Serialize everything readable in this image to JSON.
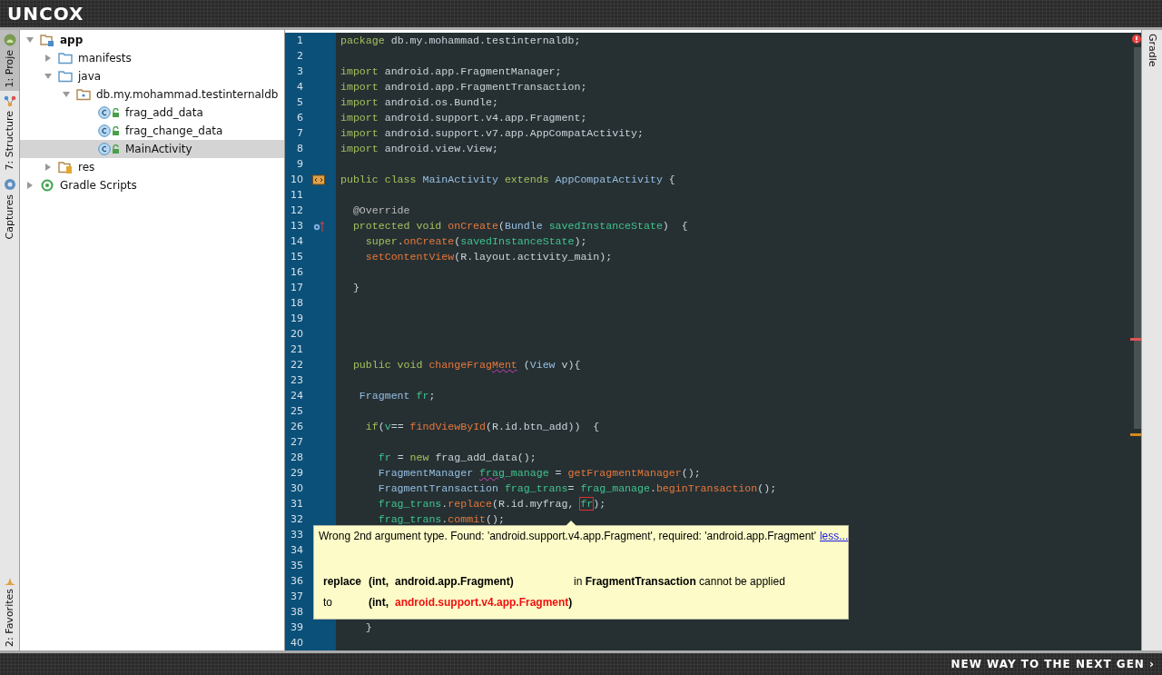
{
  "top_bar": {
    "logo": "UNCOX"
  },
  "left_tool_tabs": [
    {
      "label": "1: Proje",
      "selected": true
    },
    {
      "label": "7: Structure",
      "selected": false
    },
    {
      "label": "Captures",
      "selected": false
    },
    {
      "label": "2: Favorites",
      "selected": false
    }
  ],
  "project_tree": [
    {
      "label": "app",
      "kind": "module",
      "expanded": true,
      "selected": false,
      "children": [
        {
          "label": "manifests",
          "kind": "folder",
          "expanded": false,
          "selected": false
        },
        {
          "label": "java",
          "kind": "folder",
          "expanded": true,
          "selected": false,
          "children": [
            {
              "label": "db.my.mohammad.testinternaldb",
              "kind": "package",
              "expanded": true,
              "selected": false,
              "children": [
                {
                  "label": "frag_add_data",
                  "kind": "class",
                  "selected": false
                },
                {
                  "label": "frag_change_data",
                  "kind": "class",
                  "selected": false
                },
                {
                  "label": "MainActivity",
                  "kind": "class",
                  "selected": true
                }
              ]
            }
          ]
        },
        {
          "label": "res",
          "kind": "resources",
          "expanded": false,
          "selected": false
        }
      ]
    },
    {
      "label": "Gradle Scripts",
      "kind": "gradle",
      "expanded": false,
      "selected": false
    }
  ],
  "editor": {
    "lines": [
      {
        "number": "1",
        "tokens": [
          {
            "text": "package ",
            "kind": "keyword"
          },
          {
            "text": "db.my.mohammad.testinternaldb;",
            "kind": "plain"
          }
        ]
      },
      {
        "number": "2"
      },
      {
        "number": "3",
        "tokens": [
          {
            "text": "import ",
            "kind": "keyword"
          },
          {
            "text": "android.app.FragmentManager;",
            "kind": "plain"
          }
        ]
      },
      {
        "number": "4",
        "tokens": [
          {
            "text": "import ",
            "kind": "keyword"
          },
          {
            "text": "android.app.FragmentTransaction;",
            "kind": "plain"
          }
        ]
      },
      {
        "number": "5",
        "tokens": [
          {
            "text": "import ",
            "kind": "keyword"
          },
          {
            "text": "android.os.Bundle;",
            "kind": "plain"
          }
        ]
      },
      {
        "number": "6",
        "tokens": [
          {
            "text": "import ",
            "kind": "keyword"
          },
          {
            "text": "android.support.v4.app.Fragment;",
            "kind": "plain"
          }
        ]
      },
      {
        "number": "7",
        "tokens": [
          {
            "text": "import ",
            "kind": "keyword"
          },
          {
            "text": "android.support.v7.app.AppCompatActivity;",
            "kind": "plain"
          }
        ]
      },
      {
        "number": "8",
        "tokens": [
          {
            "text": "import ",
            "kind": "keyword"
          },
          {
            "text": "android.view.View;",
            "kind": "plain"
          }
        ]
      },
      {
        "number": "9"
      },
      {
        "number": "10",
        "kind": "implements",
        "tokens": [
          {
            "text": "public class ",
            "kind": "keyword"
          },
          {
            "text": "MainActivity ",
            "kind": "type"
          },
          {
            "text": "extends ",
            "kind": "keyword"
          },
          {
            "text": "AppCompatActivity ",
            "kind": "type"
          },
          {
            "text": "{",
            "kind": "plain"
          }
        ]
      },
      {
        "number": "11"
      },
      {
        "number": "12",
        "tokens": [
          {
            "text": "  @Override",
            "kind": "annotation"
          }
        ]
      },
      {
        "number": "13",
        "kind": "overrides",
        "tokens": [
          {
            "text": "  protected void ",
            "kind": "keyword"
          },
          {
            "text": "onCreate",
            "kind": "method"
          },
          {
            "text": "(",
            "kind": "plain"
          },
          {
            "text": "Bundle ",
            "kind": "type"
          },
          {
            "text": "savedInstanceState",
            "kind": "variable"
          },
          {
            "text": ")  {",
            "kind": "plain"
          }
        ]
      },
      {
        "number": "14",
        "tokens": [
          {
            "text": "    super",
            "kind": "keyword"
          },
          {
            "text": ".",
            "kind": "plain"
          },
          {
            "text": "onCreate",
            "kind": "method"
          },
          {
            "text": "(",
            "kind": "plain"
          },
          {
            "text": "savedInstanceState",
            "kind": "variable"
          },
          {
            "text": ");",
            "kind": "plain"
          }
        ]
      },
      {
        "number": "15",
        "tokens": [
          {
            "text": "    setContentView",
            "kind": "method"
          },
          {
            "text": "(R.layout.activity_main);",
            "kind": "plain"
          }
        ]
      },
      {
        "number": "16"
      },
      {
        "number": "17",
        "tokens": [
          {
            "text": "  }",
            "kind": "plain"
          }
        ]
      },
      {
        "number": "18"
      },
      {
        "number": "19"
      },
      {
        "number": "20"
      },
      {
        "number": "21"
      },
      {
        "number": "22",
        "tokens": [
          {
            "text": "  public void ",
            "kind": "keyword"
          },
          {
            "text": "changeFrag",
            "kind": "method"
          },
          {
            "text": "Ment",
            "kind": "method",
            "warning": true
          },
          {
            "text": " (",
            "kind": "plain"
          },
          {
            "text": "View ",
            "kind": "type"
          },
          {
            "text": "v){",
            "kind": "plain"
          }
        ]
      },
      {
        "number": "23"
      },
      {
        "number": "24",
        "tokens": [
          {
            "text": "   Fragment ",
            "kind": "type"
          },
          {
            "text": "fr",
            "kind": "variable"
          },
          {
            "text": ";",
            "kind": "plain"
          }
        ]
      },
      {
        "number": "25"
      },
      {
        "number": "26",
        "tokens": [
          {
            "text": "    if",
            "kind": "keyword"
          },
          {
            "text": "(",
            "kind": "plain"
          },
          {
            "text": "v",
            "kind": "variable"
          },
          {
            "text": "== ",
            "kind": "plain"
          },
          {
            "text": "findViewById",
            "kind": "method"
          },
          {
            "text": "(R.id.btn_add))  {",
            "kind": "plain"
          }
        ]
      },
      {
        "number": "27"
      },
      {
        "number": "28",
        "tokens": [
          {
            "text": "      fr",
            "kind": "variable"
          },
          {
            "text": " = ",
            "kind": "plain"
          },
          {
            "text": "new ",
            "kind": "keyword"
          },
          {
            "text": "frag_add_data();",
            "kind": "plain"
          }
        ]
      },
      {
        "number": "29",
        "tokens": [
          {
            "text": "      FragmentManager ",
            "kind": "type"
          },
          {
            "text": "frag",
            "kind": "variable",
            "warning": true
          },
          {
            "text": "_manage",
            "kind": "variable"
          },
          {
            "text": " = ",
            "kind": "plain"
          },
          {
            "text": "getFragmentManager",
            "kind": "method"
          },
          {
            "text": "();",
            "kind": "plain"
          }
        ]
      },
      {
        "number": "30",
        "tokens": [
          {
            "text": "      FragmentTransaction ",
            "kind": "type"
          },
          {
            "text": "frag_trans",
            "kind": "variable"
          },
          {
            "text": "= ",
            "kind": "plain"
          },
          {
            "text": "frag_manage",
            "kind": "variable"
          },
          {
            "text": ".",
            "kind": "plain"
          },
          {
            "text": "beginTransaction",
            "kind": "method"
          },
          {
            "text": "();",
            "kind": "plain"
          }
        ]
      },
      {
        "number": "31",
        "tokens": [
          {
            "text": "      frag_trans",
            "kind": "variable"
          },
          {
            "text": ".",
            "kind": "plain"
          },
          {
            "text": "replace",
            "kind": "method"
          },
          {
            "text": "(R.id.myfrag, ",
            "kind": "plain"
          },
          {
            "text": "fr",
            "kind": "variable",
            "error": true
          },
          {
            "text": ");",
            "kind": "plain"
          }
        ]
      },
      {
        "number": "32",
        "tokens": [
          {
            "text": "      frag_trans",
            "kind": "variable"
          },
          {
            "text": ".",
            "kind": "plain"
          },
          {
            "text": "commit",
            "kind": "method"
          },
          {
            "text": "();",
            "kind": "plain"
          }
        ]
      },
      {
        "number": "33"
      },
      {
        "number": "34"
      },
      {
        "number": "35"
      },
      {
        "number": "36"
      },
      {
        "number": "37"
      },
      {
        "number": "38"
      },
      {
        "number": "39",
        "tokens": [
          {
            "text": "    }",
            "kind": "plain"
          }
        ]
      },
      {
        "number": "40"
      }
    ]
  },
  "tooltip": {
    "message": "Wrong 2nd argument type. Found: 'android.support.v4.app.Fragment', required: 'android.app.Fragment'",
    "link": "less...",
    "rows": [
      [
        {
          "parts": [
            {
              "text": "replace",
              "kind": "bold"
            }
          ]
        },
        {
          "parts": [
            {
              "text": "(int,",
              "kind": "bold"
            }
          ]
        },
        {
          "parts": [
            {
              "text": "android.app.Fragment)",
              "kind": "bold"
            }
          ]
        },
        {
          "parts": [
            {
              "text": "in ",
              "kind": "plain"
            },
            {
              "text": "FragmentTransaction",
              "kind": "bold"
            },
            {
              "text": " cannot be applied",
              "kind": "plain"
            }
          ]
        }
      ],
      [
        {
          "parts": [
            {
              "text": "to",
              "kind": "plain"
            }
          ]
        },
        {
          "parts": [
            {
              "text": "(int,",
              "kind": "bold"
            }
          ]
        },
        {
          "parts": [
            {
              "text": "android.support.v4.app.Fragment",
              "kind": "mismatch"
            },
            {
              "text": ")",
              "kind": "bold"
            }
          ]
        }
      ]
    ]
  },
  "right_tool_tabs": [
    {
      "label": "Gradle",
      "selected": false
    }
  ],
  "bottom_bar": {
    "slogan": "NEW WAY TO THE NEXT GEN ›"
  }
}
